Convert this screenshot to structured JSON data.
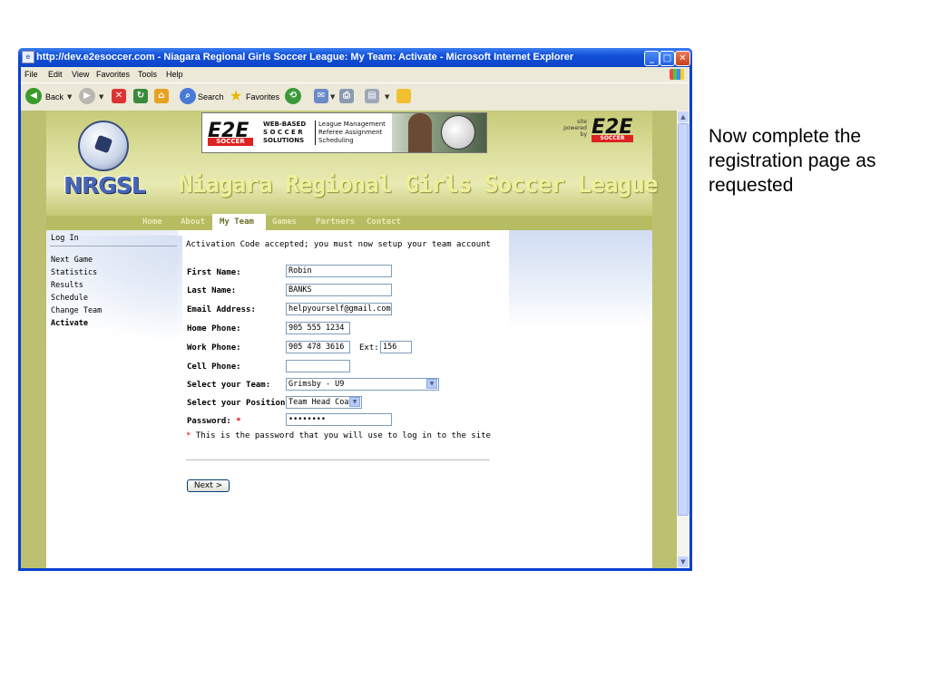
{
  "caption": "Now complete the registration page as requested",
  "window": {
    "title": "http://dev.e2esoccer.com - Niagara Regional Girls Soccer League: My Team: Activate - Microsoft Internet Explorer",
    "minimize": "_",
    "maximize": "□",
    "close": "✕"
  },
  "menu": [
    "File",
    "Edit",
    "View",
    "Favorites",
    "Tools",
    "Help"
  ],
  "toolbar": {
    "back": "Back",
    "search": "Search",
    "favorites": "Favorites"
  },
  "header": {
    "logo_text": "NRGSL",
    "site_title": "Niagara Regional Girls Soccer League",
    "banner_logo": "E2E",
    "banner_soccer": "SOCCER",
    "banner_words": [
      "WEB-BASED",
      "S O C C E R",
      "SOLUTIONS"
    ],
    "banner_features": [
      "League Management",
      "Referee Assignment",
      "Scheduling"
    ],
    "powered_by": [
      "site",
      "powered",
      "by"
    ],
    "powered_logo": "E2E",
    "powered_soccer": "SOCCER"
  },
  "nav": [
    "Home",
    "About",
    "My Team",
    "Games",
    "Partners",
    "Contact"
  ],
  "sidebar": {
    "login": "Log In",
    "items": [
      "Next Game",
      "Statistics",
      "Results",
      "Schedule",
      "Change Team",
      "Activate"
    ]
  },
  "form": {
    "message": "Activation Code accepted; you must now setup your team account",
    "labels": {
      "first_name": "First Name:",
      "last_name": "Last Name:",
      "email": "Email Address:",
      "home_phone": "Home Phone:",
      "work_phone": "Work Phone:",
      "ext": "Ext:",
      "cell_phone": "Cell Phone:",
      "team": "Select your Team:",
      "position": "Select your Position:",
      "password": "Password:",
      "required": "*"
    },
    "values": {
      "first_name": "Robin",
      "last_name": "BANKS",
      "email": "helpyourself@gmail.com",
      "home_phone": "905 555 1234",
      "work_phone": "905 478 3616",
      "ext": "156",
      "cell_phone": "",
      "team": "Grimsby - U9",
      "position": "Team Head Coach",
      "password": "••••••••"
    },
    "password_note": "This is the password that you will use to log in to the site",
    "next_button": "Next >"
  },
  "colors": {
    "title_bar": "#1250d8",
    "header_olive": "#b7bb62",
    "required_red": "#dd0000"
  }
}
